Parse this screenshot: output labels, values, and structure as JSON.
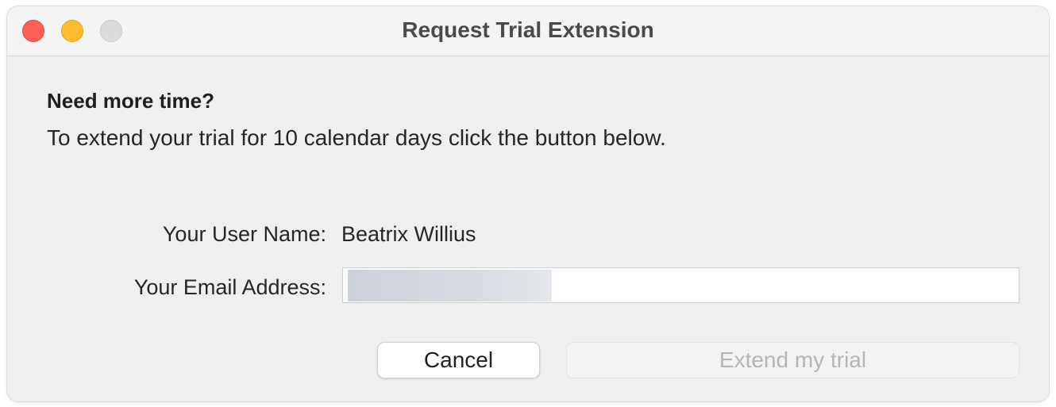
{
  "window": {
    "title": "Request Trial Extension"
  },
  "content": {
    "heading": "Need more time?",
    "description": "To extend your trial for 10 calendar days click the button below."
  },
  "form": {
    "username_label": "Your User Name:",
    "username_value": "Beatrix Willius",
    "email_label": "Your Email Address:",
    "email_value": ""
  },
  "buttons": {
    "cancel_label": "Cancel",
    "extend_label": "Extend my trial",
    "extend_enabled": false
  },
  "colors": {
    "close": "#fe5f57",
    "minimize": "#febc2e",
    "zoom_inactive": "#dcdcdc",
    "window_bg": "#efefef"
  }
}
